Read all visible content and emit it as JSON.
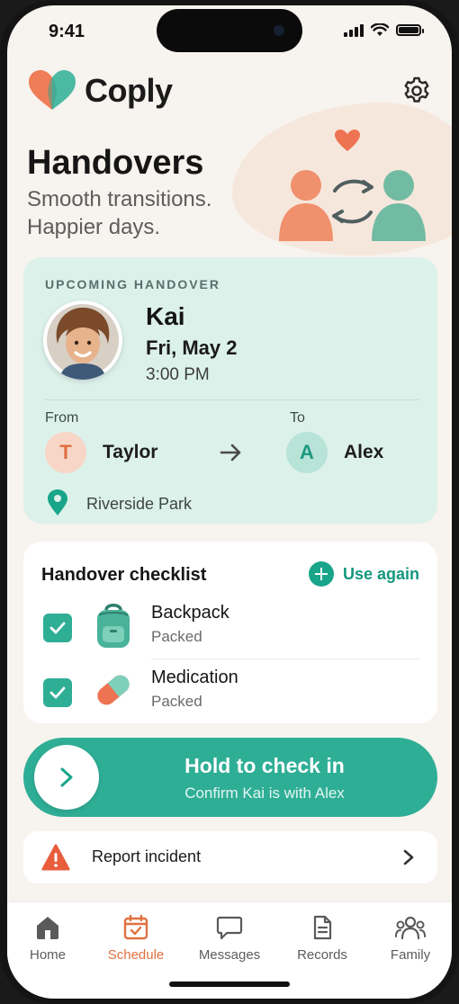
{
  "status": {
    "time": "9:41"
  },
  "app": {
    "name": "Coply"
  },
  "page": {
    "title": "Handovers",
    "subtitle_line1": "Smooth transitions.",
    "subtitle_line2": "Happier days."
  },
  "upcoming": {
    "label": "UPCOMING HANDOVER",
    "child_name": "Kai",
    "date": "Fri, May 2",
    "time": "3:00 PM",
    "from_label": "From",
    "to_label": "To",
    "from": {
      "initial": "T",
      "name": "Taylor"
    },
    "to": {
      "initial": "A",
      "name": "Alex"
    },
    "location": "Riverside Park"
  },
  "checklist": {
    "title": "Handover checklist",
    "use_again": "Use again",
    "items": [
      {
        "name": "Backpack",
        "status": "Packed",
        "checked": true,
        "icon": "backpack-icon"
      },
      {
        "name": "Medication",
        "status": "Packed",
        "checked": true,
        "icon": "pill-icon"
      }
    ]
  },
  "check_in": {
    "title": "Hold to check in",
    "subtitle": "Confirm Kai is with Alex"
  },
  "report": {
    "label": "Report incident"
  },
  "tabs": [
    {
      "label": "Home",
      "icon": "home-icon",
      "active": false
    },
    {
      "label": "Schedule",
      "icon": "calendar-icon",
      "active": true
    },
    {
      "label": "Messages",
      "icon": "message-icon",
      "active": false
    },
    {
      "label": "Records",
      "icon": "document-icon",
      "active": false
    },
    {
      "label": "Family",
      "icon": "family-icon",
      "active": false
    }
  ],
  "colors": {
    "accent": "#2fae96",
    "brand_orange": "#e0703f",
    "card_mint": "#ddf1eb",
    "background": "#f7f3ee"
  }
}
